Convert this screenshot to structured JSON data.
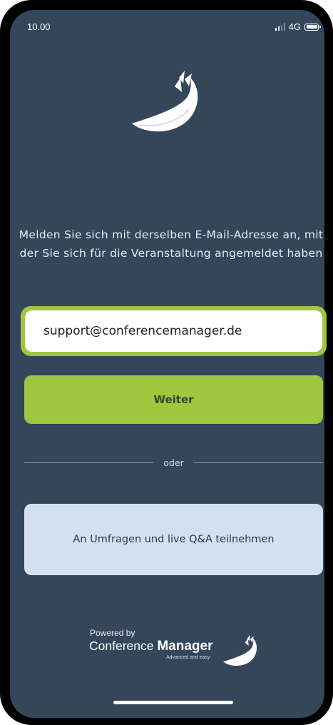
{
  "status_bar": {
    "time": "10.00",
    "network": "4G"
  },
  "icons": {
    "logo": "wing-logo-icon",
    "signal": "signal-icon",
    "battery": "battery-icon"
  },
  "login": {
    "instruction": "Melden Sie sich mit derselben E-Mail-Adresse an, mit der Sie sich für die Veranstaltung angemeldet haben",
    "email_value": "support@conferencemanager.de",
    "continue_label": "Weiter",
    "divider_label": "oder",
    "qa_label": "An Umfragen und live Q&A teilnehmen"
  },
  "footer": {
    "powered_by": "Powered by",
    "brand_light": "Conference",
    "brand_bold": "Manager",
    "tagline": "Advanced and easy"
  },
  "colors": {
    "background": "#33465a",
    "accent_green": "#9fc63d",
    "qa_button": "#d3e0f0"
  }
}
